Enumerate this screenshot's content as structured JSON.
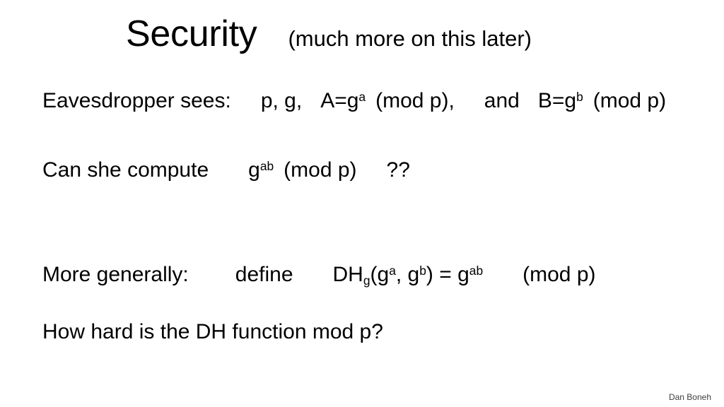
{
  "slide": {
    "background_color": "#ffffff",
    "text_color": "#000000",
    "title": {
      "main": "Security",
      "subtitle": "(much more on this later)"
    },
    "lines": {
      "eavesdropper": {
        "label": "Eavesdropper sees:",
        "params": "p, g,",
        "a_base": "A=g",
        "a_exp": "a",
        "a_mod": "(mod p),",
        "conjunction": "and",
        "b_base": "B=g",
        "b_exp": "b",
        "b_mod": "(mod p)"
      },
      "compute": {
        "question": "Can she compute",
        "base": "g",
        "exp": "ab",
        "mod": "(mod p)",
        "marks": "??"
      },
      "define": {
        "lead": "More generally:",
        "verb": "define",
        "fn_name": "DH",
        "fn_sub": "g",
        "open_paren": "(g",
        "arg1_exp": "a",
        "comma": ", g",
        "arg2_exp": "b",
        "close_paren": ") = g",
        "result_exp": "ab",
        "mod": "(mod p)"
      },
      "howhard": {
        "text": "How hard is the DH function mod p?"
      }
    },
    "footer": {
      "author": "Dan Boneh",
      "color": "#3f3f3f"
    }
  }
}
